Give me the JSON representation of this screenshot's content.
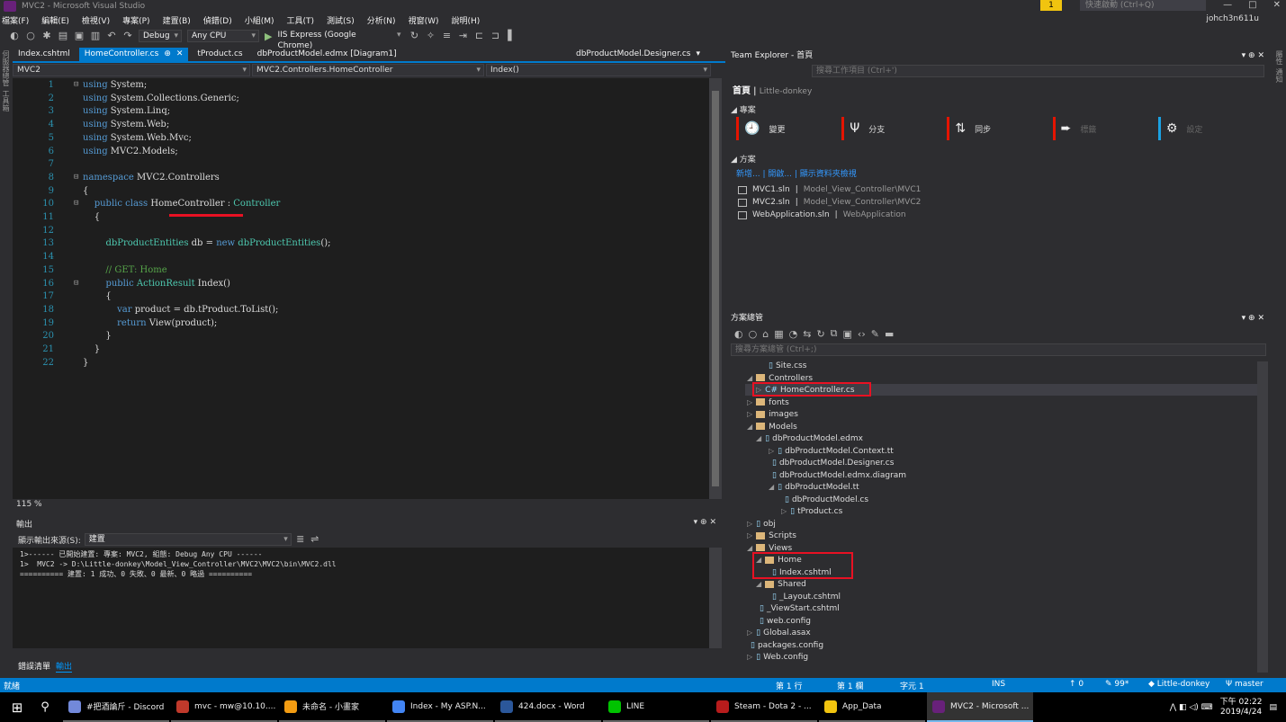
{
  "window": {
    "title": "MVC2 - Microsoft Visual Studio",
    "quick_launch": "快速啟動 (Ctrl+Q)",
    "user": "johch3n611u",
    "notif": "1"
  },
  "menu": [
    "檔案(F)",
    "編輯(E)",
    "檢視(V)",
    "專案(P)",
    "建置(B)",
    "偵錯(D)",
    "小組(M)",
    "工具(T)",
    "測試(S)",
    "分析(N)",
    "視窗(W)",
    "說明(H)"
  ],
  "toolbar": {
    "config": "Debug",
    "platform": "Any CPU",
    "run": "IIS Express (Google Chrome)"
  },
  "left_strip": [
    "伺服器總管",
    "工具箱"
  ],
  "right_strip": [
    "屬性",
    "通知"
  ],
  "doc_tabs": [
    {
      "label": "Index.cshtml"
    },
    {
      "label": "HomeController.cs"
    },
    {
      "label": "tProduct.cs"
    },
    {
      "label": "dbProductModel.edmx [Diagram1]"
    }
  ],
  "doc_tab_far": "dbProductModel.Designer.cs",
  "nav": {
    "project": "MVC2",
    "class": "MVC2.Controllers.HomeController",
    "member": "Index()"
  },
  "code": [
    {
      "n": "1",
      "t": "using System;"
    },
    {
      "n": "2",
      "t": "using System.Collections.Generic;"
    },
    {
      "n": "3",
      "t": "using System.Linq;"
    },
    {
      "n": "4",
      "t": "using System.Web;"
    },
    {
      "n": "5",
      "t": "using System.Web.Mvc;"
    },
    {
      "n": "6",
      "t": "using MVC2.Models;"
    },
    {
      "n": "7",
      "t": ""
    },
    {
      "n": "8",
      "t": "namespace MVC2.Controllers"
    },
    {
      "n": "9",
      "t": "{"
    },
    {
      "n": "10",
      "t": "    public class HomeController : Controller"
    },
    {
      "n": "11",
      "t": "    {"
    },
    {
      "n": "12",
      "t": ""
    },
    {
      "n": "13",
      "t": "        dbProductEntities db = new dbProductEntities();"
    },
    {
      "n": "14",
      "t": ""
    },
    {
      "n": "15",
      "t": "        // GET: Home"
    },
    {
      "n": "16",
      "t": "        public ActionResult Index()"
    },
    {
      "n": "17",
      "t": "        {"
    },
    {
      "n": "18",
      "t": "            var product = db.tProduct.ToList();"
    },
    {
      "n": "19",
      "t": "            return View(product);"
    },
    {
      "n": "20",
      "t": "        }"
    },
    {
      "n": "21",
      "t": "    }"
    },
    {
      "n": "22",
      "t": "}"
    }
  ],
  "zoom": "115 %",
  "output": {
    "title": "輸出",
    "source_label": "顯示輸出來源(S):",
    "source": "建置",
    "lines": [
      "1>------ 已開始建置: 專案: MVC2, 組態: Debug Any CPU ------",
      "1>  MVC2 -> D:\\Little-donkey\\Model_View_Controller\\MVC2\\MVC2\\bin\\MVC2.dll",
      "========== 建置: 1 成功、0 失敗、0 最新、0 略過 =========="
    ]
  },
  "bottom_tabs": [
    "錯誤清單",
    "輸出"
  ],
  "team_explorer": {
    "title": "Team Explorer - 首頁",
    "search": "搜尋工作項目 (Ctrl+')",
    "home": "首頁",
    "repo": "Little-donkey",
    "project_section": "專案",
    "tiles": [
      {
        "icon": "clock-icon",
        "glyph": "🕘",
        "label": "變更"
      },
      {
        "icon": "branch-icon",
        "glyph": "Ψ",
        "label": "分支"
      },
      {
        "icon": "sync-icon",
        "glyph": "⇅",
        "label": "同步"
      },
      {
        "icon": "tag-icon",
        "glyph": "➨",
        "label": "標籤"
      },
      {
        "icon": "gear-icon",
        "glyph": "⚙",
        "label": "設定"
      }
    ],
    "solution_section": "方案",
    "links": [
      "新增...",
      "開啟...",
      "顯示資料夾檢視"
    ],
    "solutions": [
      {
        "name": "MVC1.sln",
        "path": "Model_View_Controller\\MVC1"
      },
      {
        "name": "MVC2.sln",
        "path": "Model_View_Controller\\MVC2"
      },
      {
        "name": "WebApplication.sln",
        "path": "WebApplication"
      }
    ]
  },
  "solution_explorer": {
    "title": "方案總管",
    "search": "搜尋方案總管 (Ctrl+;)",
    "items": [
      {
        "label": "Site.css",
        "arrow": "",
        "type": "file"
      },
      {
        "label": "Controllers",
        "arrow": "◢",
        "type": "folder"
      },
      {
        "label": "HomeController.cs",
        "arrow": "▷",
        "type": "cs"
      },
      {
        "label": "fonts",
        "arrow": "▷",
        "type": "folder"
      },
      {
        "label": "images",
        "arrow": "▷",
        "type": "folder"
      },
      {
        "label": "Models",
        "arrow": "◢",
        "type": "folder"
      },
      {
        "label": "dbProductModel.edmx",
        "arrow": "◢",
        "type": "file"
      },
      {
        "label": "dbProductModel.Context.tt",
        "arrow": "▷",
        "type": "file"
      },
      {
        "label": "dbProductModel.Designer.cs",
        "arrow": "",
        "type": "file"
      },
      {
        "label": "dbProductModel.edmx.diagram",
        "arrow": "",
        "type": "file"
      },
      {
        "label": "dbProductModel.tt",
        "arrow": "◢",
        "type": "file"
      },
      {
        "label": "dbProductModel.cs",
        "arrow": "",
        "type": "file"
      },
      {
        "label": "tProduct.cs",
        "arrow": "▷",
        "type": "file"
      },
      {
        "label": "obj",
        "arrow": "▷",
        "type": "file"
      },
      {
        "label": "Scripts",
        "arrow": "▷",
        "type": "folder"
      },
      {
        "label": "Views",
        "arrow": "◢",
        "type": "folder"
      },
      {
        "label": "Home",
        "arrow": "◢",
        "type": "folder"
      },
      {
        "label": "Index.cshtml",
        "arrow": "",
        "type": "file"
      },
      {
        "label": "Shared",
        "arrow": "◢",
        "type": "folder"
      },
      {
        "label": "_Layout.cshtml",
        "arrow": "",
        "type": "file"
      },
      {
        "label": "_ViewStart.cshtml",
        "arrow": "",
        "type": "file"
      },
      {
        "label": "web.config",
        "arrow": "",
        "type": "file"
      },
      {
        "label": "Global.asax",
        "arrow": "▷",
        "type": "file"
      },
      {
        "label": "packages.config",
        "arrow": "",
        "type": "file"
      },
      {
        "label": "Web.config",
        "arrow": "▷",
        "type": "file"
      }
    ]
  },
  "status": {
    "ready": "就緒",
    "line": "第 1 行",
    "col": "第 1 欄",
    "char": "字元 1",
    "ins": "INS",
    "up": "↑ 0",
    "pen": "✎ 99*",
    "repo": "Little-donkey",
    "branch": "master"
  },
  "taskbar": {
    "apps": [
      {
        "label": "#把酒論斤 - Discord",
        "color": "#7289da"
      },
      {
        "label": "mvc - mw@10.10....",
        "color": "#c0392b"
      },
      {
        "label": "未命名 - 小畫家",
        "color": "#f39c12"
      },
      {
        "label": "Index - My ASP.N...",
        "color": "#4285f4"
      },
      {
        "label": "424.docx - Word",
        "color": "#2b579a"
      },
      {
        "label": "LINE",
        "color": "#00c300"
      },
      {
        "label": "Steam - Dota 2 - ...",
        "color": "#b71c1c"
      },
      {
        "label": "App_Data",
        "color": "#f1c40f"
      },
      {
        "label": "MVC2 - Microsoft ...",
        "color": "#68217a"
      }
    ],
    "clock_time": "下午 02:22",
    "clock_date": "2019/4/24"
  }
}
